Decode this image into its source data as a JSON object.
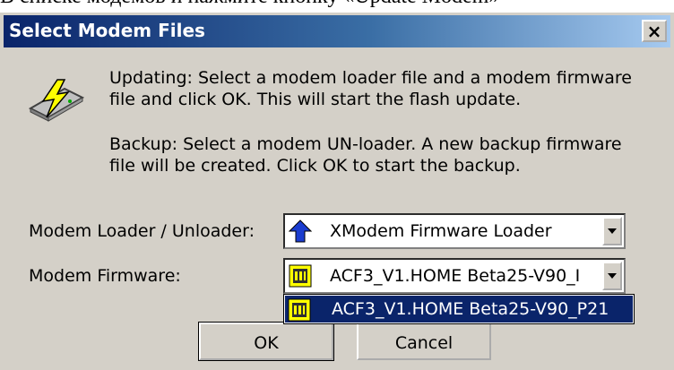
{
  "background_text": "В списке модемов и нажмите кнопку «Update Modem»",
  "dialog": {
    "title": "Select Modem Files",
    "close_glyph": "×",
    "updating_text": "Updating: Select a modem loader file and a modem firmware file and click OK. This will start the flash update.",
    "backup_text": "Backup: Select a modem UN-loader. A new backup firmware file will be created. Click OK to start the backup.",
    "loader_label": "Modem Loader / Unloader:",
    "loader_value": "XModem Firmware Loader",
    "firmware_label": "Modem Firmware:",
    "firmware_value": "ACF3_V1.HOME Beta25-V90_I",
    "dropdown_item": "ACF3_V1.HOME Beta25-V90_P21",
    "ok_label": "OK",
    "cancel_label": "Cancel"
  },
  "icons": {
    "app": "modem-flash-icon",
    "loader": "blue-up-arrow-icon",
    "firmware": "chip-icon"
  },
  "colors": {
    "dialog_bg": "#d4d0c8",
    "title_bar": "#0a246a",
    "selection": "#0a246a"
  }
}
